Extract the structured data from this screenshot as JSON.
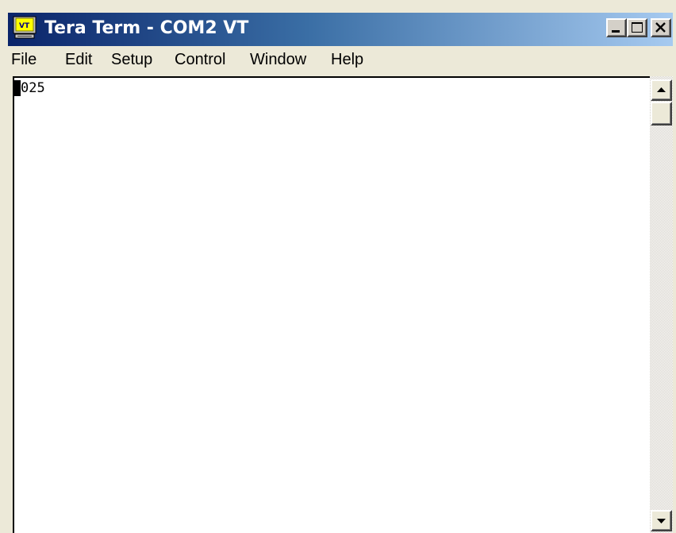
{
  "window": {
    "title": "Tera Term - COM2 VT",
    "icon": "teraterm-vt-icon"
  },
  "controls": {
    "minimize_icon": "minimize-icon",
    "maximize_icon": "maximize-icon",
    "close_icon": "close-icon"
  },
  "menu": {
    "items": [
      {
        "label": "File"
      },
      {
        "label": "Edit"
      },
      {
        "label": "Setup"
      },
      {
        "label": "Control"
      },
      {
        "label": "Window"
      },
      {
        "label": "Help"
      }
    ]
  },
  "terminal": {
    "lines": [
      "025"
    ],
    "background": "#ffffff",
    "foreground": "#000000"
  },
  "colors": {
    "titlebar_start": "#0a246a",
    "titlebar_end": "#a6caf0",
    "chrome": "#ece9d8"
  }
}
